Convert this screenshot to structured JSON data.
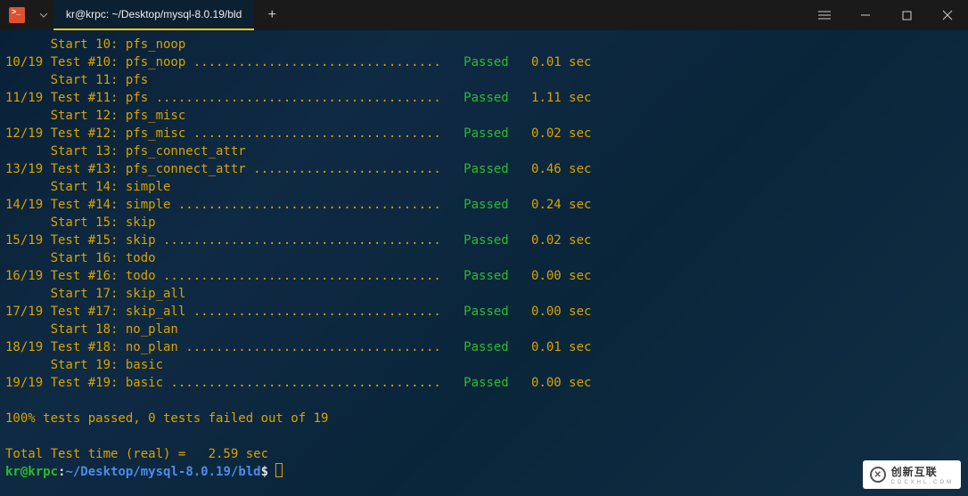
{
  "window": {
    "tab_title": "kr@krpc: ~/Desktop/mysql-8.0.19/bld"
  },
  "tests": [
    {
      "idx": "10",
      "total": "19",
      "name": "pfs_noop",
      "status": "Passed",
      "time": "0.01"
    },
    {
      "idx": "11",
      "total": "19",
      "name": "pfs",
      "status": "Passed",
      "time": "1.11"
    },
    {
      "idx": "12",
      "total": "19",
      "name": "pfs_misc",
      "status": "Passed",
      "time": "0.02"
    },
    {
      "idx": "13",
      "total": "19",
      "name": "pfs_connect_attr",
      "status": "Passed",
      "time": "0.46"
    },
    {
      "idx": "14",
      "total": "19",
      "name": "simple",
      "status": "Passed",
      "time": "0.24"
    },
    {
      "idx": "15",
      "total": "19",
      "name": "skip",
      "status": "Passed",
      "time": "0.02"
    },
    {
      "idx": "16",
      "total": "19",
      "name": "todo",
      "status": "Passed",
      "time": "0.00"
    },
    {
      "idx": "17",
      "total": "19",
      "name": "skip_all",
      "status": "Passed",
      "time": "0.00"
    },
    {
      "idx": "18",
      "total": "19",
      "name": "no_plan",
      "status": "Passed",
      "time": "0.01"
    },
    {
      "idx": "19",
      "total": "19",
      "name": "basic",
      "status": "Passed",
      "time": "0.00"
    }
  ],
  "summary": {
    "line": "100% tests passed, 0 tests failed out of 19",
    "total_time": "Total Test time (real) =   2.59 sec"
  },
  "prompt": {
    "user": "kr@krpc",
    "colon": ":",
    "path": "~/Desktop/mysql-8.0.19/bld",
    "symbol": "$"
  },
  "watermark": {
    "text": "创新互联",
    "sub": "CDCXHL.COM"
  }
}
